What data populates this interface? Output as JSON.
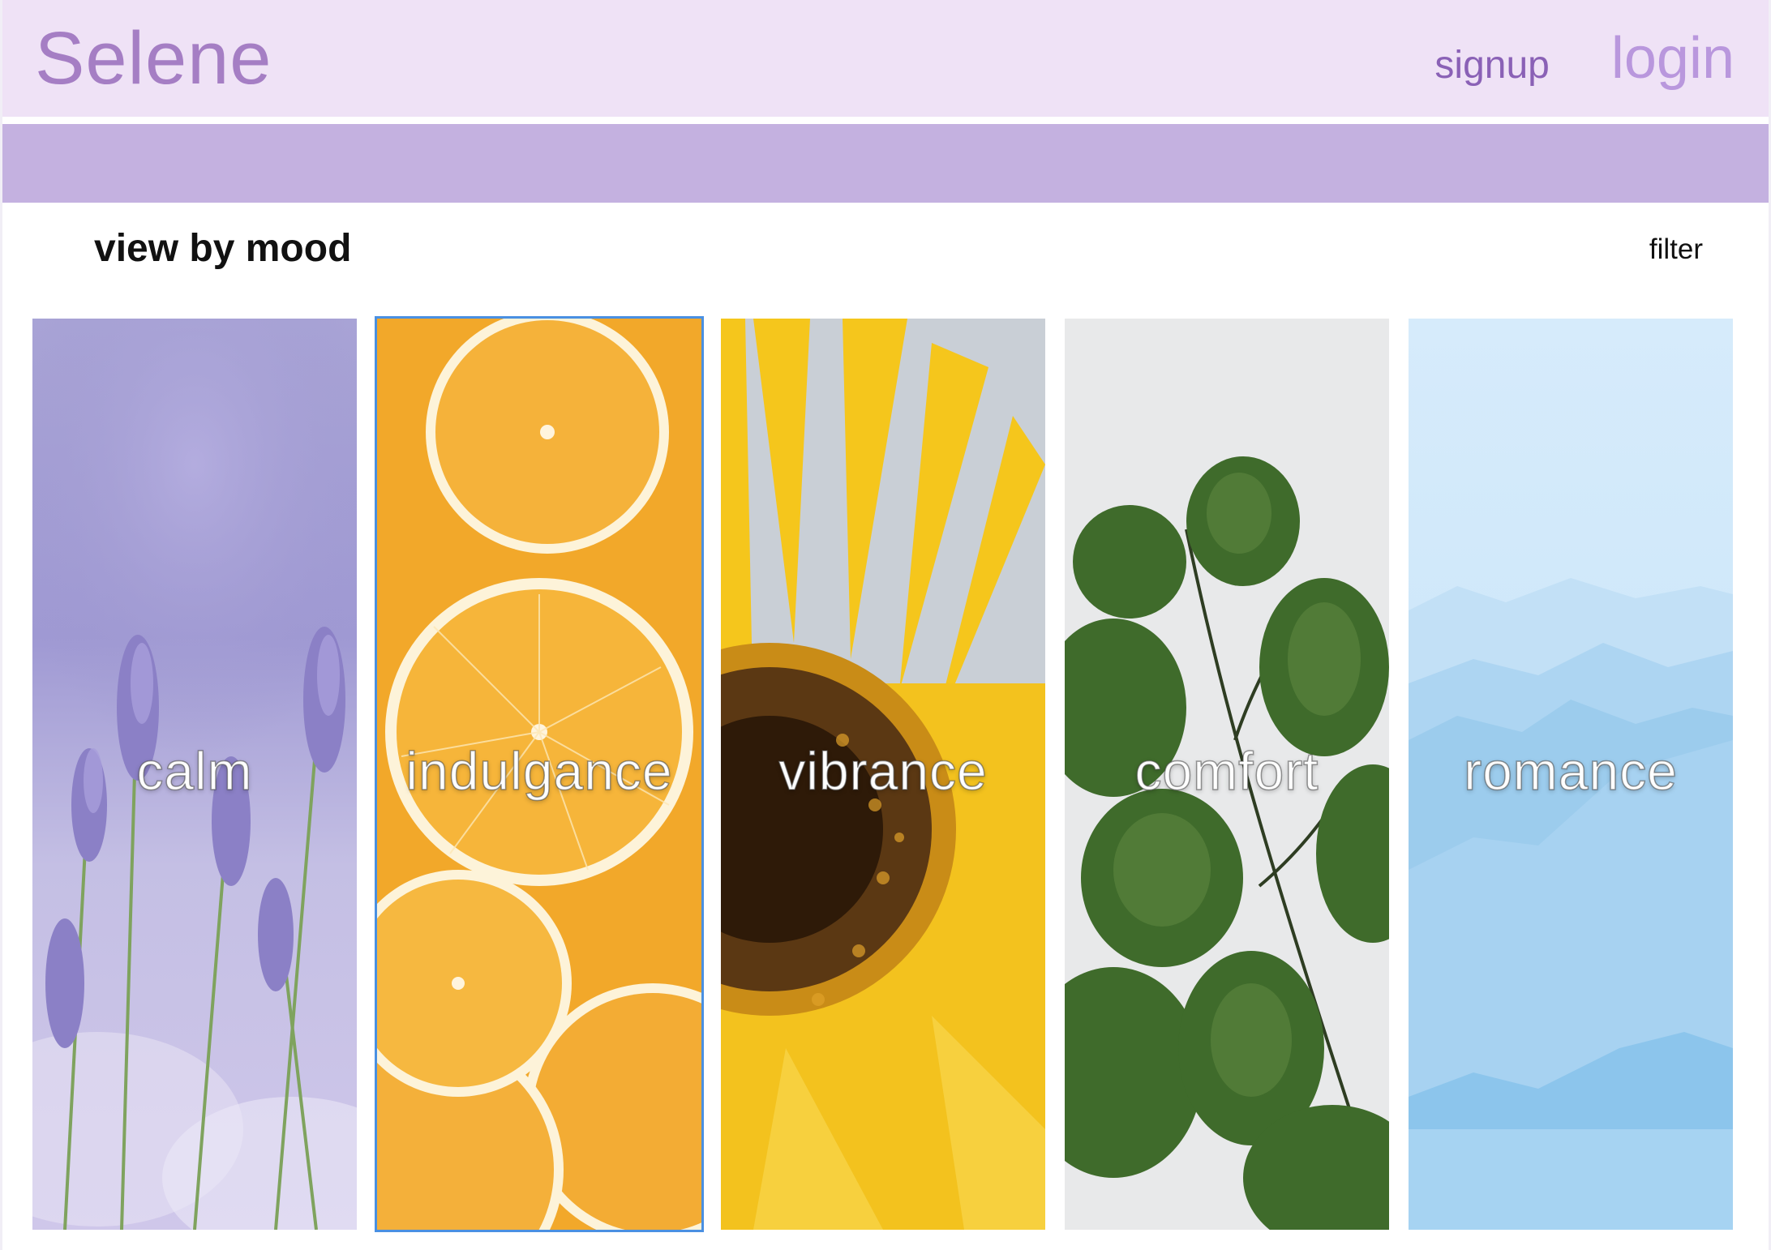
{
  "header": {
    "brand": "Selene",
    "signup_label": "signup",
    "login_label": "login"
  },
  "main": {
    "section_title": "view by mood",
    "filter_label": "filter"
  },
  "moods": [
    {
      "label": "calm",
      "selected": false,
      "image": "lavender-field"
    },
    {
      "label": "indulgance",
      "selected": true,
      "image": "orange-slices"
    },
    {
      "label": "vibrance",
      "selected": false,
      "image": "sunflower"
    },
    {
      "label": "comfort",
      "selected": false,
      "image": "green-leaves"
    },
    {
      "label": "romance",
      "selected": false,
      "image": "misty-blue-mountains"
    }
  ],
  "colors": {
    "header_bg": "#efe2f6",
    "band_bg": "#c4b1e0",
    "brand": "#a57ec4",
    "signup": "#8a61b6",
    "login": "#b997dd",
    "selection_outline": "#4a90e2"
  }
}
